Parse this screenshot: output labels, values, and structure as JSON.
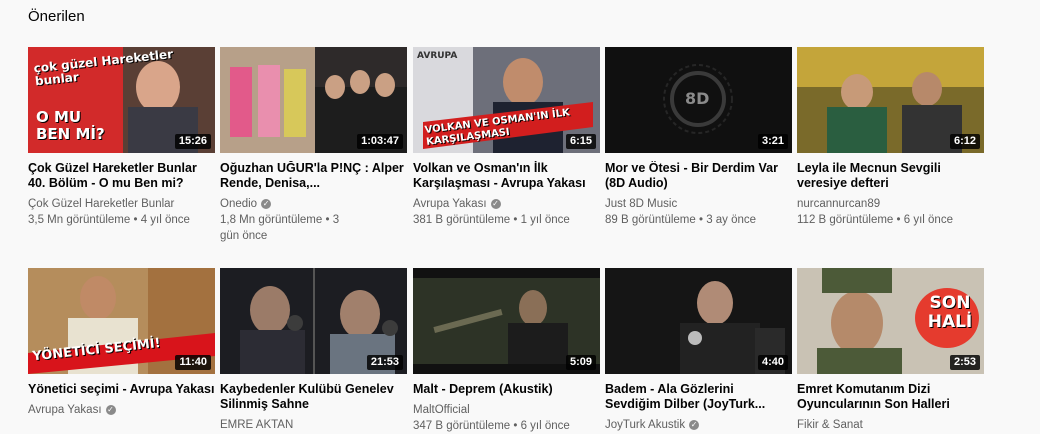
{
  "section": {
    "title": "Önerilen"
  },
  "videos": [
    {
      "title": "Çok Güzel Hareketler Bunlar 40. Bölüm - O mu Ben mi?",
      "channel": "Çok Güzel Hareketler Bunlar",
      "verified": false,
      "meta": "3,5 Mn görüntüleme • 4 yıl önce",
      "duration": "15:26",
      "overlay": "O MU BEN Mİ?",
      "logo_text": "çok güzel Hareketler bunlar"
    },
    {
      "title": "Oğuzhan UĞUR'la P!NÇ : Alper Rende, Denisa,...",
      "channel": "Onedio",
      "verified": true,
      "meta": "1,8 Mn görüntüleme • 3 gün önce",
      "duration": "1:03:47",
      "overlay": ""
    },
    {
      "title": "Volkan ve Osman'ın İlk Karşılaşması - Avrupa Yakası",
      "channel": "Avrupa Yakası",
      "verified": true,
      "meta": "381 B görüntüleme • 1 yıl önce",
      "duration": "6:15",
      "overlay": "VOLKAN VE OSMAN'IN İLK KARŞILAŞMASI",
      "logo_text": "AVRUPA"
    },
    {
      "title": "Mor ve Ötesi - Bir Derdim Var (8D Audio)",
      "channel": "Just 8D Music",
      "verified": false,
      "meta": "89 B görüntüleme • 3 ay önce",
      "duration": "3:21",
      "overlay": "8D"
    },
    {
      "title": "Leyla ile Mecnun Sevgili veresiye defteri",
      "channel": "nurcannurcan89",
      "verified": false,
      "meta": "112 B görüntüleme • 6 yıl önce",
      "duration": "6:12",
      "overlay": ""
    },
    {
      "title": "Yönetici seçimi - Avrupa Yakası",
      "channel": "Avrupa Yakası",
      "verified": true,
      "meta": "",
      "duration": "11:40",
      "overlay": "YÖNETİCİ SEÇİMİ!"
    },
    {
      "title": "Kaybedenler Kulübü Genelev Silinmiş Sahne",
      "channel": "EMRE AKTAN",
      "verified": false,
      "meta": "",
      "duration": "21:53",
      "overlay": ""
    },
    {
      "title": "Malt - Deprem (Akustik)",
      "channel": "MaltOfficial",
      "verified": false,
      "meta": "347 B görüntüleme • 6 yıl önce",
      "duration": "5:09",
      "overlay": ""
    },
    {
      "title": "Badem - Ala Gözlerini Sevdiğim Dilber (JoyTurk...",
      "channel": "JoyTurk Akustik",
      "verified": true,
      "meta": "",
      "duration": "4:40",
      "overlay": ""
    },
    {
      "title": "Emret Komutanım Dizi Oyuncularının Son Halleri",
      "channel": "Fikir & Sanat",
      "verified": false,
      "meta": "",
      "duration": "2:53",
      "overlay": "SON HALİ"
    }
  ]
}
